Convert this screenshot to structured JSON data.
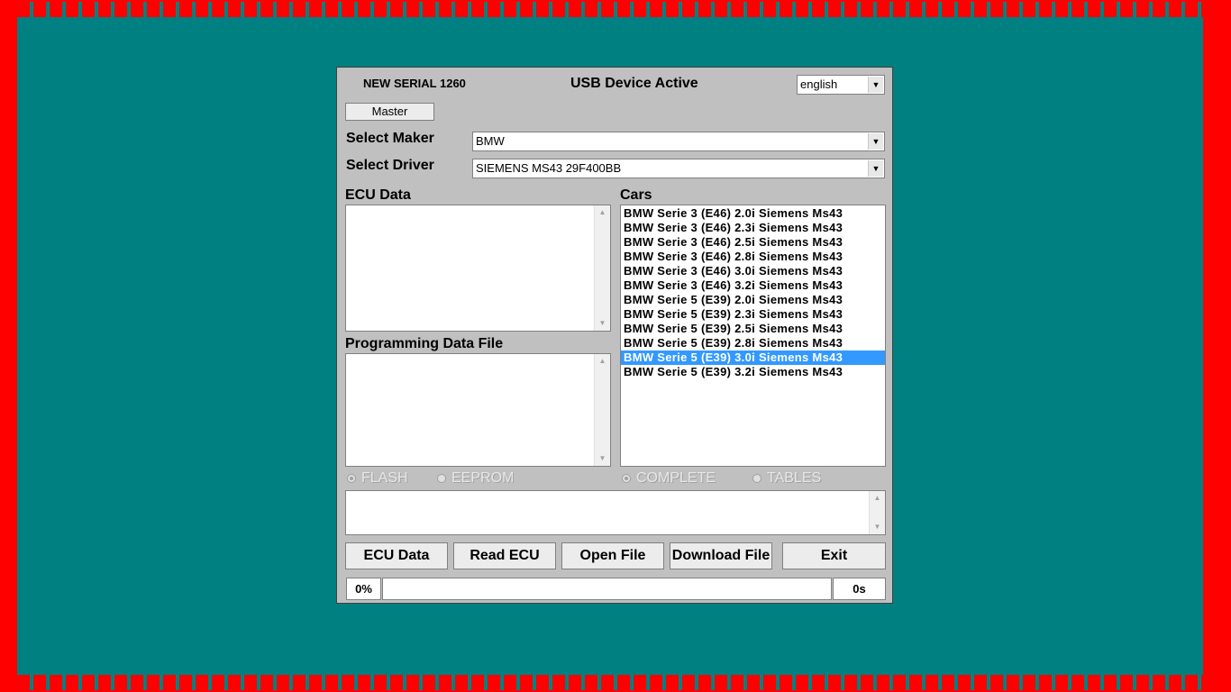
{
  "dialog": {
    "serial": "NEW SERIAL 1260",
    "status": "USB Device Active",
    "language": "english",
    "master_label": "Master"
  },
  "maker": {
    "label": "Select Maker",
    "value": "BMW"
  },
  "driver": {
    "label": "Select Driver",
    "value": "SIEMENS MS43 29F400BB"
  },
  "ecu_data": {
    "label": "ECU Data"
  },
  "programming": {
    "label": "Programming Data File"
  },
  "cars": {
    "label": "Cars",
    "items": [
      "BMW Serie 3 (E46) 2.0i Siemens Ms43",
      "BMW Serie 3 (E46) 2.3i Siemens Ms43",
      "BMW Serie 3 (E46) 2.5i Siemens Ms43",
      "BMW Serie 3 (E46) 2.8i Siemens Ms43",
      "BMW Serie 3 (E46) 3.0i Siemens Ms43",
      "BMW Serie 3 (E46) 3.2i Siemens Ms43",
      "BMW Serie 5 (E39) 2.0i Siemens Ms43",
      "BMW Serie 5 (E39) 2.3i Siemens Ms43",
      "BMW Serie 5 (E39) 2.5i Siemens Ms43",
      "BMW Serie 5 (E39) 2.8i Siemens Ms43",
      "BMW Serie 5 (E39) 3.0i Siemens Ms43",
      "BMW Serie 5 (E39) 3.2i Siemens Ms43"
    ],
    "selected_index": 10
  },
  "radios": {
    "flash": "FLASH",
    "eeprom": "EEPROM",
    "complete": "COMPLETE",
    "tables": "TABLES"
  },
  "buttons": {
    "ecu_data": "ECU Data",
    "read_ecu": "Read ECU",
    "open_file": "Open File",
    "download_file": "Download File",
    "exit": "Exit"
  },
  "progress": {
    "percent_text": "0%",
    "percent": 0,
    "time_text": "0s"
  },
  "colors": {
    "selection": "#3399ff",
    "background": "#008080",
    "frame": "#ff0000"
  },
  "icons": {
    "dropdown": "chevron-down-icon",
    "scroll_up": "scroll-up-arrow-icon",
    "scroll_down": "scroll-down-arrow-icon"
  }
}
